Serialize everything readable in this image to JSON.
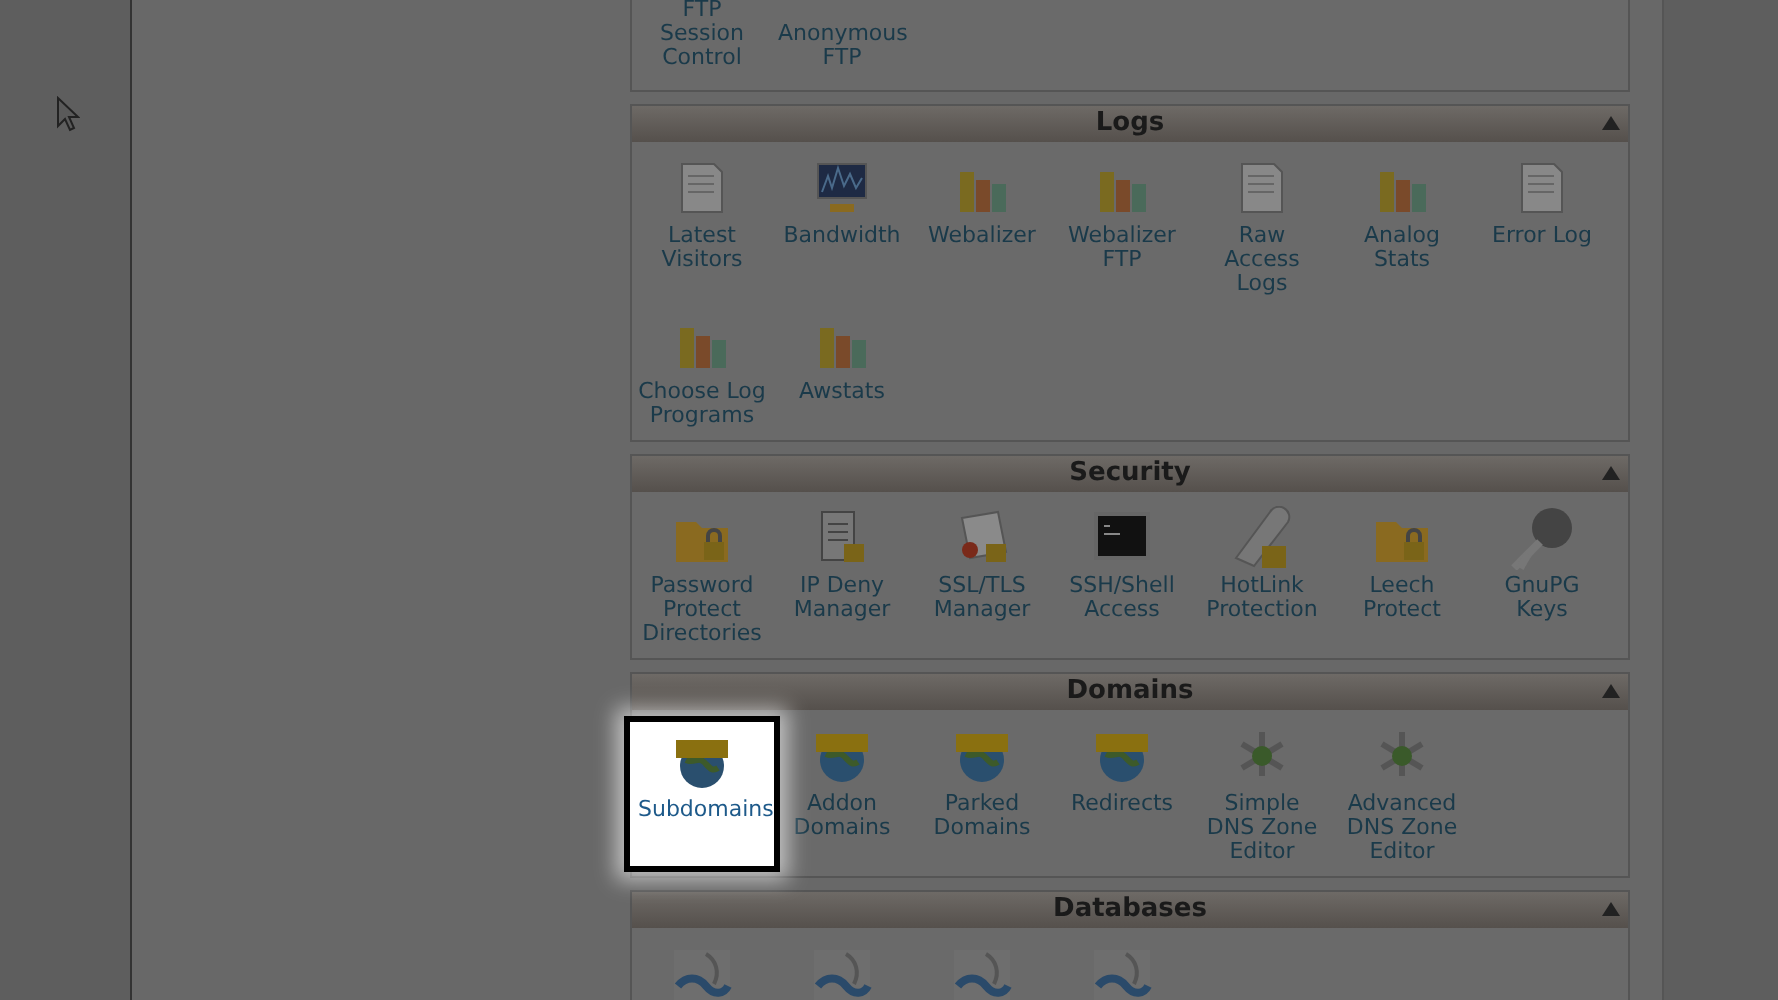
{
  "partial_section": {
    "items": [
      {
        "label": "FTP Session Control",
        "selected": false
      },
      {
        "label": "Anonymous FTP",
        "selected": false
      }
    ]
  },
  "sections": [
    {
      "title": "Logs",
      "items": [
        {
          "label": "Latest Visitors",
          "selected": false
        },
        {
          "label": "Bandwidth",
          "selected": false
        },
        {
          "label": "Webalizer",
          "selected": false
        },
        {
          "label": "Webalizer FTP",
          "selected": false
        },
        {
          "label": "Raw Access Logs",
          "selected": false
        },
        {
          "label": "Analog Stats",
          "selected": false
        },
        {
          "label": "Error Log",
          "selected": false
        },
        {
          "label": "Choose Log Programs",
          "selected": false
        },
        {
          "label": "Awstats",
          "selected": false
        }
      ]
    },
    {
      "title": "Security",
      "items": [
        {
          "label": "Password Protect Directories",
          "selected": false
        },
        {
          "label": "IP Deny Manager",
          "selected": false
        },
        {
          "label": "SSL/TLS Manager",
          "selected": false
        },
        {
          "label": "SSH/Shell Access",
          "selected": false
        },
        {
          "label": "HotLink Protection",
          "selected": false
        },
        {
          "label": "Leech Protect",
          "selected": false
        },
        {
          "label": "GnuPG Keys",
          "selected": false
        }
      ]
    },
    {
      "title": "Domains",
      "items": [
        {
          "label": "Subdomains",
          "selected": true
        },
        {
          "label": "Addon Domains",
          "selected": false
        },
        {
          "label": "Parked Domains",
          "selected": false
        },
        {
          "label": "Redirects",
          "selected": false
        },
        {
          "label": "Simple DNS Zone Editor",
          "selected": false
        },
        {
          "label": "Advanced DNS Zone Editor",
          "selected": false
        }
      ]
    },
    {
      "title": "Databases",
      "items": [
        {
          "selected": false
        },
        {
          "selected": false
        },
        {
          "selected": false
        },
        {
          "selected": false
        }
      ]
    }
  ]
}
